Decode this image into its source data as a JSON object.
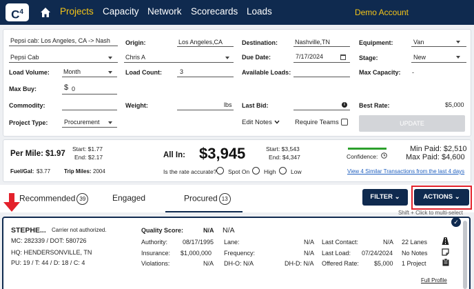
{
  "nav": {
    "logo_text": "C",
    "logo_sup": "4",
    "items": [
      "Projects",
      "Capacity",
      "Network",
      "Scorecards",
      "Loads"
    ],
    "account": "Demo Account"
  },
  "form": {
    "project_name": "Pepsi cab: Los Angeles, CA -> Nash",
    "customer": "Pepsi Cab",
    "load_volume_label": "Load Volume:",
    "load_volume": "Month",
    "max_buy_label": "Max Buy:",
    "max_buy_prefix": "$",
    "max_buy": "0",
    "commodity_label": "Commodity:",
    "project_type_label": "Project Type:",
    "project_type": "Procurement",
    "origin_label": "Origin:",
    "origin": "Los Angeles,CA",
    "owner": "Chris A",
    "load_count_label": "Load Count:",
    "load_count": "3",
    "weight_label": "Weight:",
    "weight_unit": "lbs",
    "destination_label": "Destination:",
    "destination": "Nashville,TN",
    "due_date_label": "Due Date:",
    "due_date": "7/17/2024",
    "available_loads_label": "Available Loads:",
    "last_bid_label": "Last Bid:",
    "edit_notes": "Edit Notes",
    "require_teams": "Require Teams",
    "equipment_label": "Equipment:",
    "equipment": "Van",
    "stage_label": "Stage:",
    "stage": "New",
    "max_capacity_label": "Max Capacity:",
    "max_capacity": "-",
    "best_rate_label": "Best Rate:",
    "best_rate": "$5,000",
    "update": "UPDATE"
  },
  "summary": {
    "per_mile_label": "Per Mile:",
    "per_mile": "$1.97",
    "pm_start": "Start: $1.77",
    "pm_end": "End: $2.17",
    "fuel_label": "Fuel/Gal:",
    "fuel": "$3.77",
    "trip_label": "Trip Miles:",
    "trip": "2004",
    "all_in_label": "All In:",
    "all_in": "$3,945",
    "ai_start": "Start: $3,543",
    "ai_end": "End: $4,347",
    "accurate_q": "Is the rate accurate?",
    "spot_on": "Spot On",
    "high": "High",
    "low": "Low",
    "confidence": "Confidence:",
    "min_paid": "Min Paid: $2,510",
    "max_paid": "Max Paid: $4,600",
    "similar_link": "View 4 Similar Transactions from the last 4 days"
  },
  "tabs": [
    {
      "label": "Recommended",
      "count": "39"
    },
    {
      "label": "Engaged",
      "count": ""
    },
    {
      "label": "Procured",
      "count": "13"
    }
  ],
  "buttons": {
    "filter": "FILTER",
    "actions": "ACTIONS",
    "hint": "Shift + Click to multi-select"
  },
  "carrier": {
    "name": "STEPHE...",
    "status": "Carrier not authorized.",
    "mc": "MC: 282339 / DOT: 580726",
    "hq": "HQ:  HENDERSONVILLE, TN",
    "pu": "PU: 19  /  T: 44  /  D: 18 / C: 4",
    "quality_label": "Quality Score:",
    "quality": "N/A",
    "quality2": "N/A",
    "authority_label": "Authority:",
    "authority": "08/17/1995",
    "insurance_label": "Insurance:",
    "insurance": "$1,000,000",
    "violations_label": "Violations:",
    "violations": "N/A",
    "lane_label": "Lane:",
    "lane": "N/A",
    "frequency_label": "Frequency:",
    "frequency": "N/A",
    "dho_label": "DH-O: N/A",
    "dhd_label": "DH-D: N/A",
    "last_contact_label": "Last Contact:",
    "last_contact": "N/A",
    "last_load_label": "Last Load:",
    "last_load": "07/24/2024",
    "offered_label": "Offered Rate:",
    "offered": "$5,000",
    "lanes": "22 Lanes",
    "notes": "No Notes",
    "projects": "1 Project",
    "full_profile": "Full Profile"
  }
}
